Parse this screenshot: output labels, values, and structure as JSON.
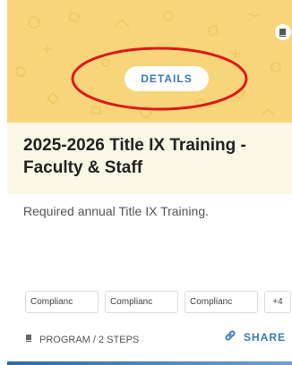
{
  "card": {
    "details_label": "DETAILS",
    "title": "2025-2026 Title IX Training - Faculty & Staff",
    "description": "Required annual Title IX Training.",
    "tags": [
      "Complianc",
      "Complianc",
      "Complianc"
    ],
    "more_tags": "+4",
    "program_info": "PROGRAM / 2 STEPS",
    "share_label": "SHARE",
    "type_icon": "book-icon",
    "colors": {
      "banner": "#f7d57a",
      "accent": "#3a78b5",
      "annotation": "#e01818"
    }
  }
}
